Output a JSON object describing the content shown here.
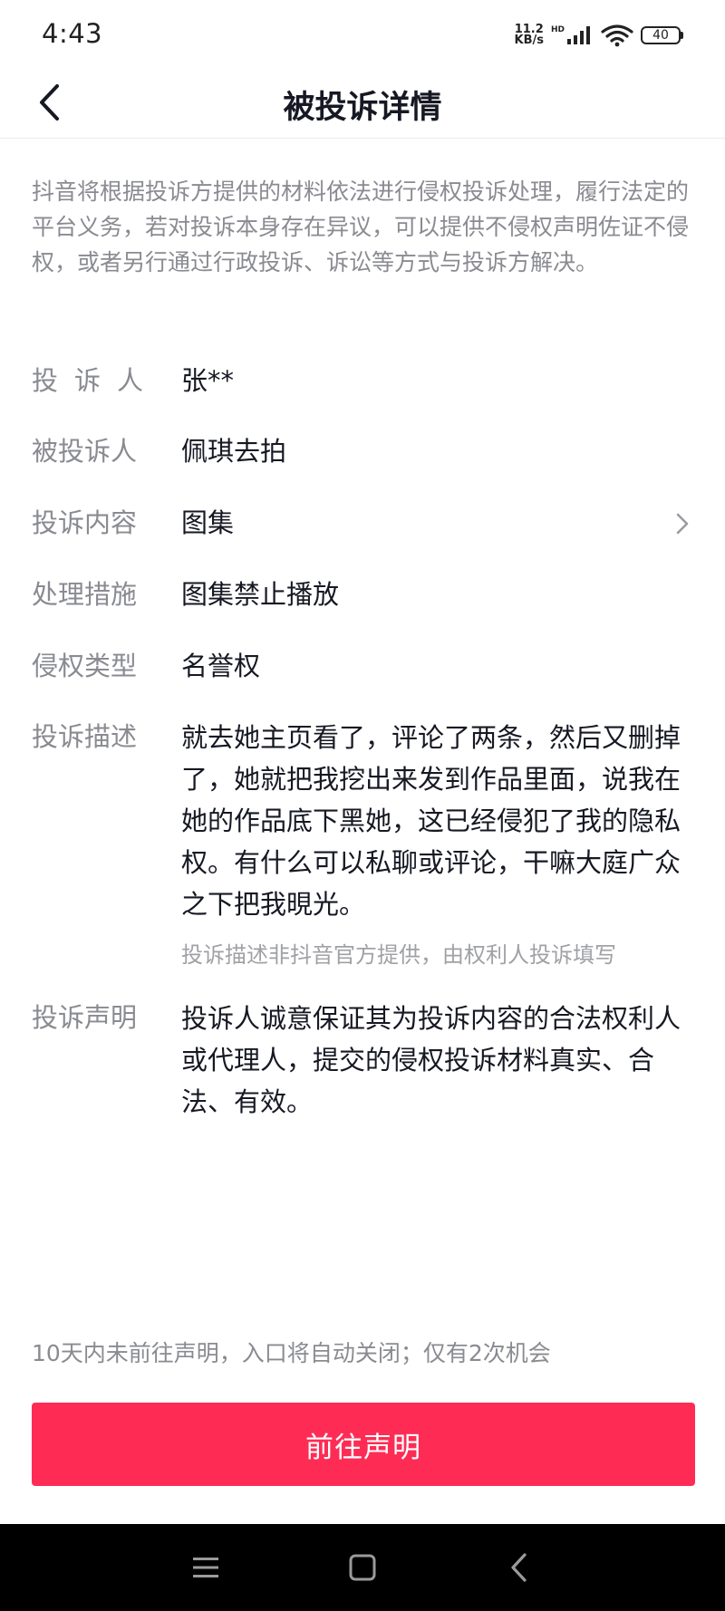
{
  "status_bar": {
    "time": "4:43",
    "net_speed_value": "11.2",
    "net_speed_unit": "KB/s",
    "hd_label": "HD",
    "battery": "40",
    "icons": [
      "signal-icon",
      "wifi-icon",
      "battery-icon"
    ]
  },
  "nav": {
    "title": "被投诉详情",
    "back_icon": "chevron-left-icon"
  },
  "notice": "抖音将根据投诉方提供的材料依法进行侵权投诉处理，履行法定的平台义务，若对投诉本身存在异议，可以提供不侵权声明佐证不侵权，或者另行通过行政投诉、诉讼等方式与投诉方解决。",
  "details": {
    "complainant": {
      "label": "投诉人",
      "value": "张**"
    },
    "respondent": {
      "label": "被投诉人",
      "value": "佩琪去拍"
    },
    "content": {
      "label": "投诉内容",
      "value": "图集",
      "arrow_icon": "chevron-right-icon"
    },
    "measure": {
      "label": "处理措施",
      "value": "图集禁止播放"
    },
    "infringement_type": {
      "label": "侵权类型",
      "value": "名誉权"
    },
    "description": {
      "label": "投诉描述",
      "value": "就去她主页看了，评论了两条，然后又删掉了，她就把我挖出来发到作品里面，说我在她的作品底下黑她，这已经侵犯了我的隐私权。有什么可以私聊或评论，干嘛大庭广众之下把我晛光。",
      "note": "投诉描述非抖音官方提供，由权利人投诉填写"
    },
    "statement": {
      "label": "投诉声明",
      "value": "投诉人诚意保证其为投诉内容的合法权利人或代理人，提交的侵权投诉材料真实、合法、有效。"
    }
  },
  "deadline_hint": "10天内未前往声明，入口将自动关闭；仅有2次机会",
  "primary_button": "前往声明",
  "system_nav": {
    "icons": [
      "menu-icon",
      "home-icon",
      "back-icon"
    ]
  },
  "colors": {
    "accent": "#fe2c55",
    "text_primary": "#161823",
    "text_secondary": "#8a8b91"
  }
}
